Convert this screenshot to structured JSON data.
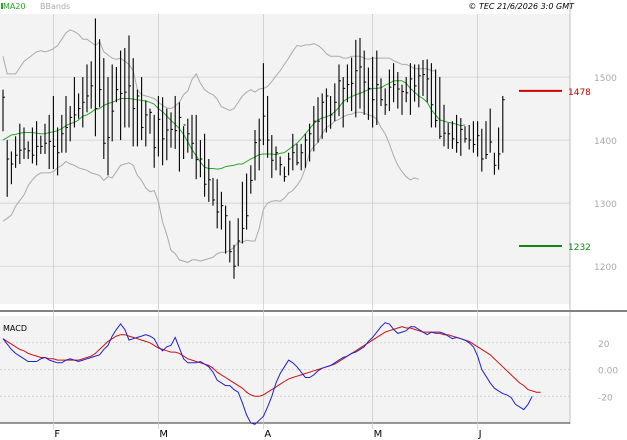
{
  "header": {
    "legend_ma": "MA20",
    "legend_bb": "BBands",
    "copyright": "© TEC 21/6/2026 3:0 GMT"
  },
  "colors": {
    "price": "#000000",
    "ma": "#2aa52a",
    "bands": "#aaaaaa",
    "macd": "#2020d0",
    "signal": "#cc1010",
    "resistance": "#cc0000",
    "support": "#118811",
    "grid": "#c8c8c8",
    "panel_bg": "#f3f3f3"
  },
  "chart_data": [
    {
      "type": "ohlc",
      "title": "",
      "ylim": [
        1140,
        1600
      ],
      "yticks": [
        {
          "value": 1200,
          "label": "1200"
        },
        {
          "value": 1300,
          "label": "1300"
        },
        {
          "value": 1400,
          "label": "1400"
        },
        {
          "value": 1500,
          "label": "1500"
        }
      ],
      "months": [
        "F",
        "M",
        "A",
        "M",
        "J"
      ],
      "month_start_index": [
        12,
        37,
        62,
        88,
        113
      ],
      "levels": [
        {
          "name": "resistance",
          "value": 1478,
          "label": "1478"
        },
        {
          "name": "support",
          "value": 1232,
          "label": "1232"
        }
      ],
      "high": [
        1480,
        1400,
        1382,
        1406,
        1426,
        1420,
        1398,
        1420,
        1430,
        1407,
        1426,
        1440,
        1470,
        1420,
        1440,
        1470,
        1454,
        1500,
        1474,
        1500,
        1520,
        1525,
        1593,
        1560,
        1530,
        1500,
        1520,
        1516,
        1542,
        1546,
        1566,
        1530,
        1480,
        1500,
        1463,
        1450,
        1440,
        1470,
        1468,
        1450,
        1444,
        1470,
        1460,
        1422,
        1434,
        1440,
        1440,
        1400,
        1410,
        1370,
        1340,
        1338,
        1318,
        1296,
        1272,
        1234,
        1276,
        1334,
        1347,
        1360,
        1416,
        1434,
        1522,
        1470,
        1408,
        1390,
        1374,
        1358,
        1380,
        1410,
        1394,
        1394,
        1410,
        1426,
        1454,
        1468,
        1474,
        1482,
        1470,
        1490,
        1520,
        1500,
        1520,
        1531,
        1559,
        1562,
        1542,
        1515,
        1532,
        1542,
        1498,
        1482,
        1512,
        1522,
        1508,
        1488,
        1500,
        1522,
        1520,
        1520,
        1527,
        1528,
        1522,
        1512,
        1500,
        1456,
        1427,
        1430,
        1440,
        1435,
        1422,
        1424,
        1430,
        1430,
        1418,
        1430,
        1450,
        1380,
        1420,
        1470
      ],
      "low": [
        1414,
        1310,
        1330,
        1356,
        1362,
        1370,
        1370,
        1363,
        1360,
        1378,
        1378,
        1354,
        1354,
        1344,
        1380,
        1380,
        1398,
        1420,
        1434,
        1420,
        1444,
        1450,
        1406,
        1452,
        1370,
        1344,
        1398,
        1460,
        1400,
        1420,
        1420,
        1390,
        1390,
        1400,
        1390,
        1410,
        1356,
        1374,
        1360,
        1368,
        1388,
        1386,
        1350,
        1370,
        1380,
        1370,
        1338,
        1341,
        1310,
        1302,
        1296,
        1260,
        1258,
        1220,
        1206,
        1180,
        1200,
        1236,
        1258,
        1315,
        1336,
        1352,
        1392,
        1372,
        1340,
        1352,
        1344,
        1334,
        1344,
        1352,
        1360,
        1352,
        1356,
        1366,
        1382,
        1396,
        1402,
        1412,
        1418,
        1430,
        1438,
        1420,
        1460,
        1446,
        1436,
        1450,
        1440,
        1432,
        1420,
        1424,
        1454,
        1440,
        1446,
        1460,
        1450,
        1440,
        1460,
        1440,
        1461,
        1452,
        1470,
        1460,
        1420,
        1420,
        1402,
        1390,
        1386,
        1386,
        1380,
        1375,
        1396,
        1385,
        1380,
        1374,
        1350,
        1370,
        1380,
        1345,
        1353,
        1380
      ],
      "close": [
        1468,
        1370,
        1362,
        1376,
        1384,
        1386,
        1383,
        1376,
        1390,
        1390,
        1395,
        1398,
        1390,
        1380,
        1410,
        1420,
        1436,
        1440,
        1450,
        1460,
        1470,
        1486,
        1450,
        1480,
        1395,
        1404,
        1446,
        1480,
        1474,
        1476,
        1486,
        1450,
        1470,
        1420,
        1440,
        1444,
        1388,
        1433,
        1402,
        1416,
        1417,
        1415,
        1436,
        1424,
        1410,
        1395,
        1369,
        1370,
        1330,
        1337,
        1305,
        1286,
        1296,
        1280,
        1223,
        1200,
        1240,
        1260,
        1280,
        1336,
        1396,
        1400,
        1438,
        1400,
        1368,
        1380,
        1361,
        1342,
        1370,
        1380,
        1364,
        1380,
        1400,
        1410,
        1430,
        1430,
        1460,
        1470,
        1440,
        1460,
        1494,
        1482,
        1488,
        1490,
        1510,
        1516,
        1492,
        1482,
        1464,
        1488,
        1464,
        1456,
        1484,
        1488,
        1481,
        1477,
        1475,
        1497,
        1486,
        1502,
        1504,
        1497,
        1456,
        1431,
        1406,
        1411,
        1410,
        1402,
        1396,
        1417,
        1402,
        1400,
        1393,
        1407,
        1370,
        1377,
        1397,
        1360,
        1378,
        1464
      ],
      "ma20": [
        1400,
        1404,
        1408,
        1409,
        1411,
        1412,
        1412,
        1412,
        1411,
        1410,
        1410,
        1412,
        1413,
        1415,
        1418,
        1423,
        1426,
        1428,
        1432,
        1438,
        1440,
        1444,
        1449,
        1450,
        1455,
        1458,
        1460,
        1463,
        1466,
        1466,
        1466,
        1465,
        1464,
        1463,
        1462,
        1460,
        1457,
        1450,
        1445,
        1438,
        1431,
        1425,
        1418,
        1409,
        1397,
        1385,
        1375,
        1365,
        1357,
        1355,
        1355,
        1354,
        1355,
        1358,
        1359,
        1360,
        1362,
        1362,
        1366,
        1370,
        1373,
        1377,
        1378,
        1378,
        1378,
        1377,
        1379,
        1380,
        1385,
        1390,
        1395,
        1402,
        1410,
        1418,
        1426,
        1432,
        1435,
        1437,
        1440,
        1445,
        1452,
        1461,
        1466,
        1469,
        1472,
        1474,
        1477,
        1480,
        1482,
        1482,
        1483,
        1487,
        1490,
        1494,
        1494,
        1494,
        1490,
        1482,
        1476,
        1470,
        1466,
        1460,
        1448,
        1440,
        1432,
        1430,
        1428,
        1427,
        1425,
        1423,
        1424
      ],
      "bb_upper": [
        1533,
        1505,
        1505,
        1505,
        1515,
        1525,
        1530,
        1535,
        1540,
        1542,
        1540,
        1542,
        1545,
        1550,
        1560,
        1570,
        1575,
        1572,
        1568,
        1560,
        1560,
        1555,
        1550,
        1556,
        1540,
        1535,
        1530,
        1528,
        1530,
        1525,
        1520,
        1510,
        1480,
        1472,
        1470,
        1468,
        1466,
        1460,
        1455,
        1451,
        1450,
        1454,
        1460,
        1472,
        1478,
        1496,
        1505,
        1490,
        1480,
        1475,
        1472,
        1465,
        1453,
        1450,
        1447,
        1450,
        1460,
        1470,
        1476,
        1480,
        1476,
        1481,
        1482,
        1485,
        1493,
        1502,
        1510,
        1520,
        1530,
        1541,
        1550,
        1549,
        1551,
        1551,
        1553,
        1550,
        1545,
        1537,
        1533,
        1533,
        1533,
        1530,
        1530,
        1533,
        1533,
        1533,
        1530,
        1528,
        1530,
        1530,
        1530,
        1530,
        1530,
        1526,
        1523,
        1520,
        1520,
        1517,
        1513,
        1513,
        1513,
        1513,
        1510,
        1510
      ],
      "bb_lower": [
        1271,
        1276,
        1281,
        1295,
        1304,
        1313,
        1328,
        1337,
        1344,
        1348,
        1348,
        1348,
        1350,
        1356,
        1360,
        1366,
        1362,
        1360,
        1356,
        1354,
        1352,
        1348,
        1346,
        1344,
        1336,
        1342,
        1340,
        1350,
        1360,
        1362,
        1364,
        1360,
        1344,
        1336,
        1324,
        1318,
        1320,
        1302,
        1270,
        1250,
        1225,
        1220,
        1210,
        1208,
        1206,
        1210,
        1210,
        1208,
        1210,
        1212,
        1214,
        1220,
        1222,
        1222,
        1225,
        1230,
        1238,
        1238,
        1241,
        1240,
        1240,
        1260,
        1290,
        1300,
        1303,
        1304,
        1303,
        1308,
        1316,
        1320,
        1328,
        1338,
        1356,
        1380,
        1390,
        1396,
        1410,
        1420,
        1424,
        1430,
        1433,
        1437,
        1440,
        1441,
        1444,
        1444,
        1443,
        1440,
        1438,
        1433,
        1420,
        1410,
        1394,
        1375,
        1360,
        1350,
        1342,
        1337,
        1340,
        1338
      ]
    },
    {
      "type": "line",
      "title": "MACD",
      "ylim": [
        -40,
        40
      ],
      "yticks": [
        {
          "value": 20,
          "label": "20"
        },
        {
          "value": 0,
          "label": "0.00"
        },
        {
          "value": -20,
          "label": "-20"
        }
      ],
      "series": [
        {
          "name": "MACD",
          "values": [
            23,
            19,
            15,
            12,
            10,
            8,
            6,
            6,
            6,
            8,
            9,
            7,
            6,
            5,
            5,
            7,
            8,
            7,
            6,
            7,
            8,
            9,
            10,
            11,
            15,
            18,
            25,
            30,
            34,
            30,
            22,
            23,
            24,
            25,
            26,
            25,
            23,
            17,
            14,
            17,
            18,
            24,
            16,
            8,
            5,
            5,
            5,
            6,
            4,
            2,
            -2,
            -8,
            -10,
            -12,
            -12,
            -15,
            -17,
            -25,
            -34,
            -40,
            -41,
            -38,
            -35,
            -28,
            -20,
            -10,
            -3,
            2,
            7,
            5,
            2,
            -2,
            -6,
            -6,
            -4,
            -1,
            1,
            2,
            3,
            5,
            7,
            9,
            10,
            12,
            13,
            15,
            17,
            21,
            24,
            28,
            32,
            35,
            34,
            30,
            27,
            28,
            29,
            32,
            32,
            30,
            28,
            26,
            28,
            28,
            28,
            27,
            25,
            23,
            24,
            23,
            22,
            20,
            17,
            10,
            0,
            -5,
            -10,
            -14,
            -16,
            -18,
            -19,
            -21,
            -26,
            -28,
            -30,
            -26,
            -20
          ]
        },
        {
          "name": "Signal",
          "values": [
            23,
            21,
            19,
            17,
            15,
            14,
            12,
            11,
            10,
            9,
            9,
            8,
            8,
            7,
            7,
            7,
            7,
            7,
            7,
            8,
            9,
            10,
            12,
            15,
            18,
            21,
            23,
            25,
            26,
            26,
            25,
            24,
            23,
            22,
            21,
            20,
            18,
            16,
            15,
            14,
            13,
            13,
            12,
            10,
            8,
            7,
            6,
            5,
            4,
            3,
            1,
            -2,
            -4,
            -6,
            -8,
            -10,
            -12,
            -14,
            -17,
            -19,
            -20,
            -20,
            -19,
            -17,
            -15,
            -13,
            -11,
            -9,
            -7,
            -6,
            -5,
            -4,
            -3,
            -2,
            -1,
            0,
            1,
            2,
            3,
            4,
            6,
            8,
            10,
            12,
            14,
            16,
            18,
            20,
            22,
            24,
            26,
            28,
            29,
            30,
            31,
            32,
            31,
            31,
            30,
            29,
            28,
            28,
            28,
            27,
            27,
            26,
            26,
            25,
            24,
            23,
            22,
            21,
            19,
            17,
            15,
            13,
            11,
            8,
            5,
            2,
            -1,
            -4,
            -7,
            -10,
            -12,
            -15,
            -16,
            -17,
            -17
          ]
        }
      ]
    }
  ]
}
